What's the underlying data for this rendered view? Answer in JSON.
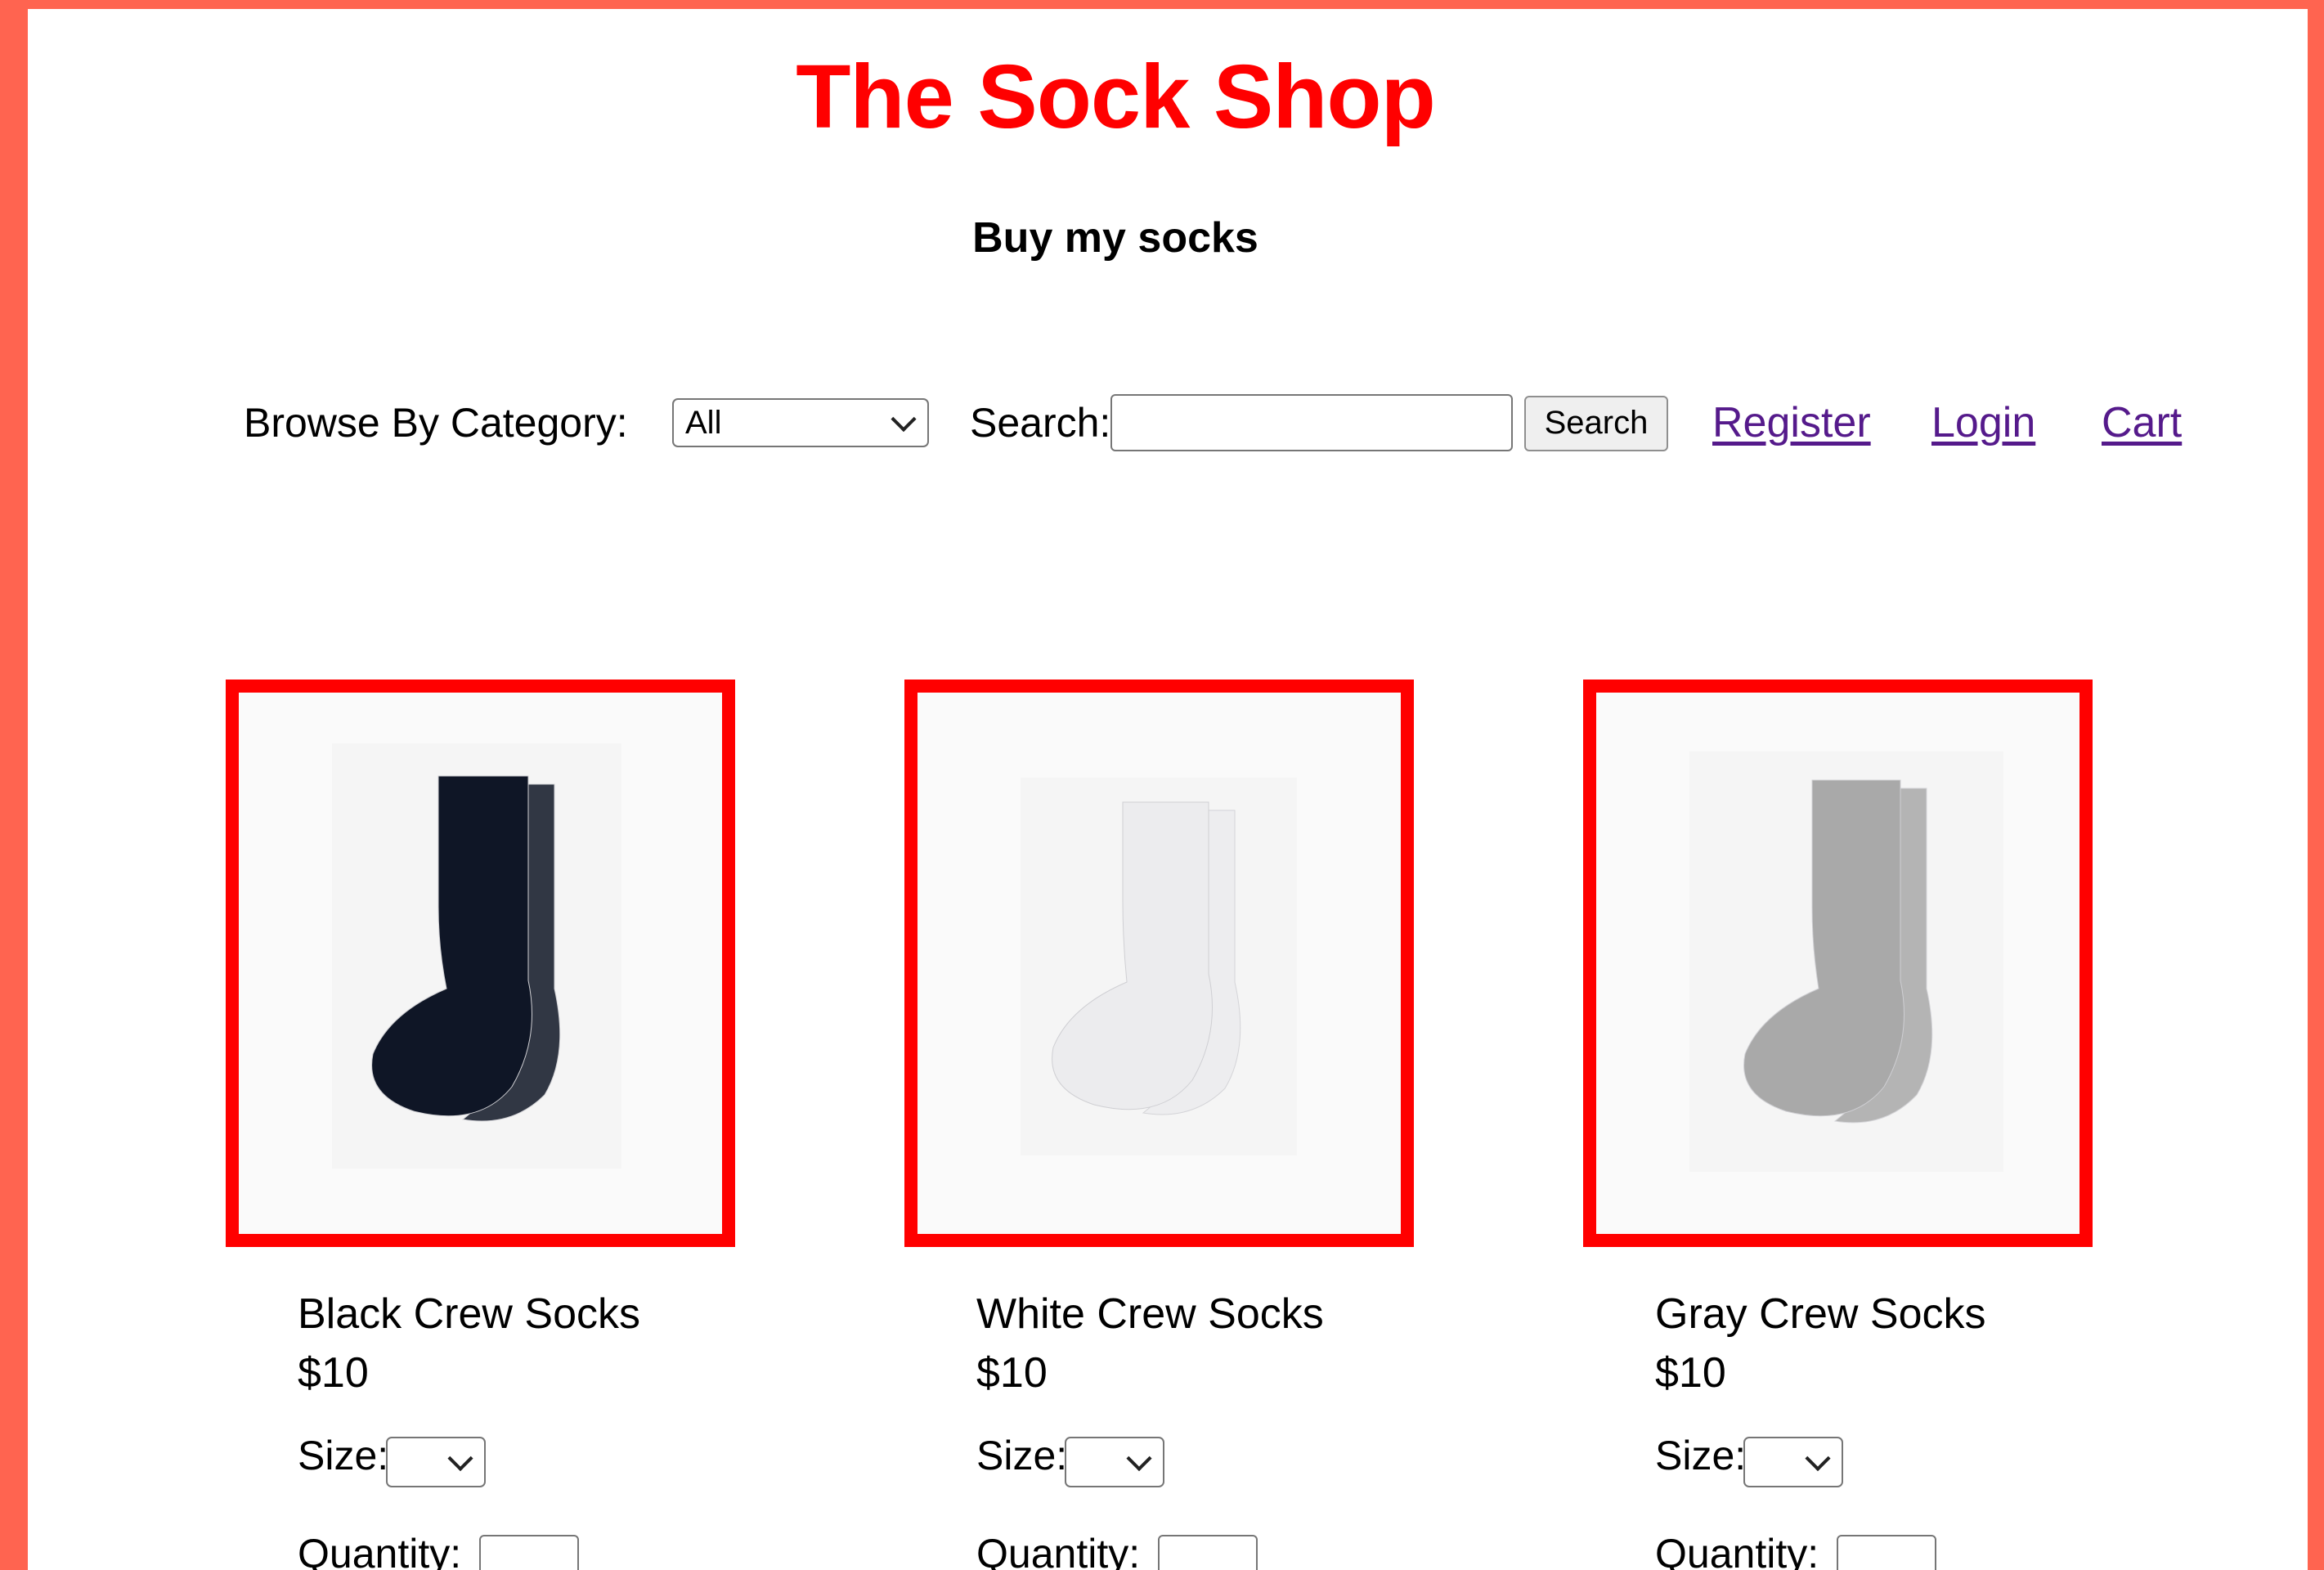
{
  "header": {
    "title": "The Sock Shop",
    "subtitle": "Buy my socks"
  },
  "nav": {
    "category_label": "Browse By Category:",
    "category_value": "All",
    "search_label": "Search:",
    "search_value": "",
    "search_button": "Search",
    "links": [
      "Register",
      "Login",
      "Cart"
    ]
  },
  "products": [
    {
      "name": "Black Crew Socks",
      "price": "$10",
      "sock_color": "#0f1626",
      "size_label": "Size:",
      "qty_label": "Quantity:"
    },
    {
      "name": "White Crew Socks",
      "price": "$10",
      "sock_color": "#ececee",
      "size_label": "Size:",
      "qty_label": "Quantity:"
    },
    {
      "name": "Gray Crew Socks",
      "price": "$10",
      "sock_color": "#a9a9a9",
      "size_label": "Size:",
      "qty_label": "Quantity:"
    }
  ],
  "colors": {
    "page_border": "#ff6450",
    "accent": "#ff0000",
    "link": "#551a8b"
  }
}
